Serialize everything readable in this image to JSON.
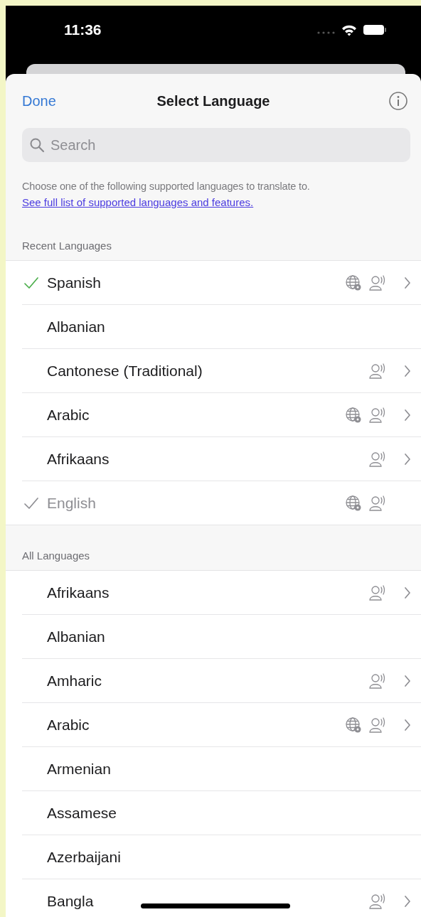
{
  "status_bar": {
    "time": "11:36"
  },
  "header": {
    "done": "Done",
    "title": "Select Language"
  },
  "search": {
    "placeholder": "Search"
  },
  "description": {
    "text": "Choose one of the following supported languages to translate to.",
    "link": "See full list of supported languages and features."
  },
  "sections": [
    {
      "title": "Recent Languages",
      "rows": [
        {
          "name": "Spanish",
          "checked": true,
          "disabled": false,
          "offline": true,
          "voice": true,
          "chevron": true
        },
        {
          "name": "Albanian",
          "checked": false,
          "disabled": false,
          "offline": false,
          "voice": false,
          "chevron": false
        },
        {
          "name": "Cantonese (Traditional)",
          "checked": false,
          "disabled": false,
          "offline": false,
          "voice": true,
          "chevron": true
        },
        {
          "name": "Arabic",
          "checked": false,
          "disabled": false,
          "offline": true,
          "voice": true,
          "chevron": true
        },
        {
          "name": "Afrikaans",
          "checked": false,
          "disabled": false,
          "offline": false,
          "voice": true,
          "chevron": true
        },
        {
          "name": "English",
          "checked": true,
          "disabled": true,
          "offline": true,
          "voice": true,
          "chevron": false
        }
      ]
    },
    {
      "title": "All Languages",
      "rows": [
        {
          "name": "Afrikaans",
          "checked": false,
          "disabled": false,
          "offline": false,
          "voice": true,
          "chevron": true
        },
        {
          "name": "Albanian",
          "checked": false,
          "disabled": false,
          "offline": false,
          "voice": false,
          "chevron": false
        },
        {
          "name": "Amharic",
          "checked": false,
          "disabled": false,
          "offline": false,
          "voice": true,
          "chevron": true
        },
        {
          "name": "Arabic",
          "checked": false,
          "disabled": false,
          "offline": true,
          "voice": true,
          "chevron": true
        },
        {
          "name": "Armenian",
          "checked": false,
          "disabled": false,
          "offline": false,
          "voice": false,
          "chevron": false
        },
        {
          "name": "Assamese",
          "checked": false,
          "disabled": false,
          "offline": false,
          "voice": false,
          "chevron": false
        },
        {
          "name": "Azerbaijani",
          "checked": false,
          "disabled": false,
          "offline": false,
          "voice": false,
          "chevron": false
        },
        {
          "name": "Bangla",
          "checked": false,
          "disabled": false,
          "offline": false,
          "voice": true,
          "chevron": true
        }
      ]
    }
  ]
}
